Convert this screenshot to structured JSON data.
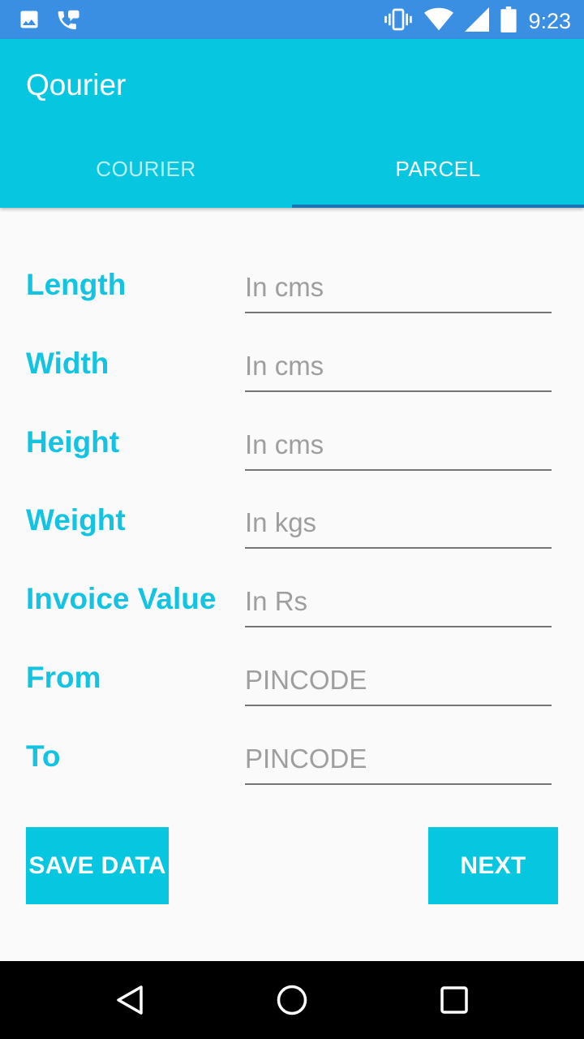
{
  "status_bar": {
    "time": "9:23",
    "left_icons": [
      "image-icon",
      "phone-chat-icon"
    ],
    "right_icons": [
      "vibrate-icon",
      "wifi-icon",
      "signal-icon",
      "battery-icon"
    ]
  },
  "app_bar": {
    "title": "Qourier"
  },
  "tabs": [
    {
      "label": "COURIER",
      "active": false
    },
    {
      "label": "PARCEL",
      "active": true
    }
  ],
  "form": {
    "fields": [
      {
        "label": "Length",
        "placeholder": "In cms",
        "value": ""
      },
      {
        "label": "Width",
        "placeholder": "In cms",
        "value": ""
      },
      {
        "label": "Height",
        "placeholder": "In cms",
        "value": ""
      },
      {
        "label": "Weight",
        "placeholder": "In kgs",
        "value": ""
      },
      {
        "label": "Invoice Value",
        "placeholder": "In Rs",
        "value": ""
      },
      {
        "label": "From",
        "placeholder": "PINCODE",
        "value": ""
      },
      {
        "label": "To",
        "placeholder": "PINCODE",
        "value": ""
      }
    ]
  },
  "buttons": {
    "save_label": "SAVE DATA",
    "next_label": "NEXT"
  },
  "nav_bar": {
    "icons": [
      "back-icon",
      "home-icon",
      "recents-icon"
    ]
  },
  "colors": {
    "accent": "#07c6e0",
    "status_bar": "#3a8fe3",
    "label": "#13c4e2",
    "tab_indicator": "#1976b4"
  }
}
